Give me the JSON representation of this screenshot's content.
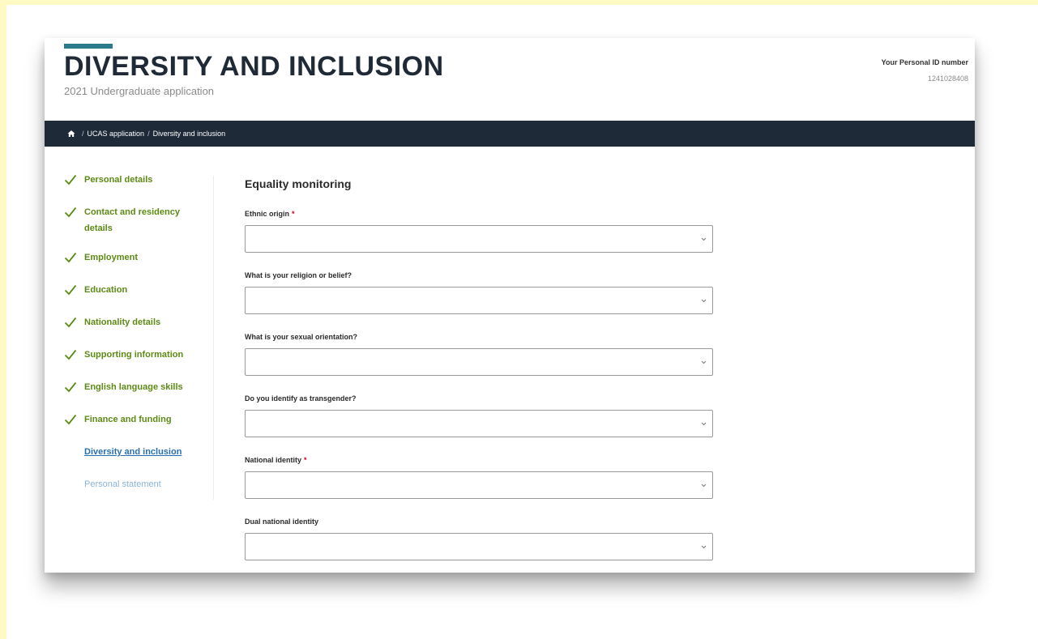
{
  "header": {
    "title": "DIVERSITY AND INCLUSION",
    "subtitle": "2021 Undergraduate application",
    "id_label": "Your Personal ID number",
    "id_value": "1241028408"
  },
  "breadcrumb": {
    "items": [
      "UCAS application",
      "Diversity and inclusion"
    ]
  },
  "sidebar": {
    "items": [
      {
        "label": "Personal details",
        "state": "complete"
      },
      {
        "label": "Contact and residency details",
        "state": "complete"
      },
      {
        "label": "Employment",
        "state": "complete"
      },
      {
        "label": "Education",
        "state": "complete"
      },
      {
        "label": "Nationality details",
        "state": "complete"
      },
      {
        "label": "Supporting information",
        "state": "complete"
      },
      {
        "label": "English language skills",
        "state": "complete"
      },
      {
        "label": "Finance and funding",
        "state": "complete"
      },
      {
        "label": "Diversity and inclusion",
        "state": "current"
      },
      {
        "label": "Personal statement",
        "state": "future"
      }
    ]
  },
  "form": {
    "section_title": "Equality monitoring",
    "required_marker": "*",
    "fields": [
      {
        "label": "Ethnic origin",
        "required": true,
        "value": ""
      },
      {
        "label": "What is your religion or belief?",
        "required": false,
        "value": ""
      },
      {
        "label": "What is your sexual orientation?",
        "required": false,
        "value": ""
      },
      {
        "label": "Do you identify as transgender?",
        "required": false,
        "value": ""
      },
      {
        "label": "National identity",
        "required": true,
        "value": ""
      },
      {
        "label": "Dual national identity",
        "required": false,
        "value": ""
      }
    ]
  },
  "colors": {
    "accent": "#2a7a8c",
    "breadcrumb_bg": "#1e2a38",
    "complete": "#5c8a14",
    "current": "#2a6fb0",
    "future": "#8ab4d8",
    "required": "#d0021b"
  },
  "icons": {
    "home": "home-icon",
    "check": "checkmark-icon",
    "chevron": "chevron-down-icon"
  }
}
